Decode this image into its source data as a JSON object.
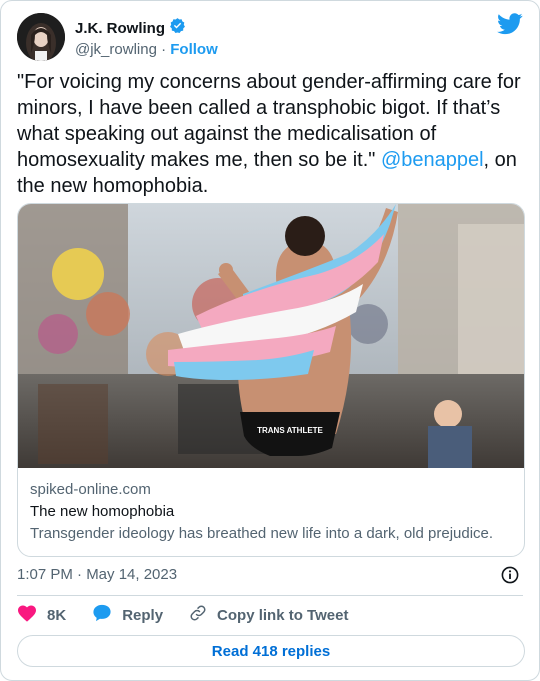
{
  "author": {
    "name": "J.K. Rowling",
    "handle": "@jk_rowling",
    "separator": "·",
    "follow_label": "Follow",
    "avatar_icon": "author-avatar",
    "verified_icon": "verified-badge-icon"
  },
  "brand": {
    "icon": "twitter-bird-icon",
    "color": "#1d9bf0"
  },
  "tweet": {
    "text_before": "\"For voicing my concerns about gender-affirming care for minors, I have been called a transphobic bigot. If that’s what speaking out against the medicalisation of homosexuality makes me, then so be it.\" ",
    "mention": "@benappel",
    "text_after": ", on the new homophobia."
  },
  "link_card": {
    "domain": "spiked-online.com",
    "title": "The new homophobia",
    "description": "Transgender ideology has breathed new life into a dark, old prejudice.",
    "image_caption_on_shorts": "TRANS ATHLETE"
  },
  "meta": {
    "timestamp": "1:07 PM · May 14, 2023",
    "info_icon": "info-icon"
  },
  "actions": {
    "like_count": "8K",
    "reply_label": "Reply",
    "copy_label": "Copy link to Tweet",
    "read_replies_label": "Read 418 replies"
  },
  "colors": {
    "accent": "#1d9bf0",
    "like": "#f91880",
    "secondary_text": "#536471",
    "border": "#cfd9de"
  }
}
